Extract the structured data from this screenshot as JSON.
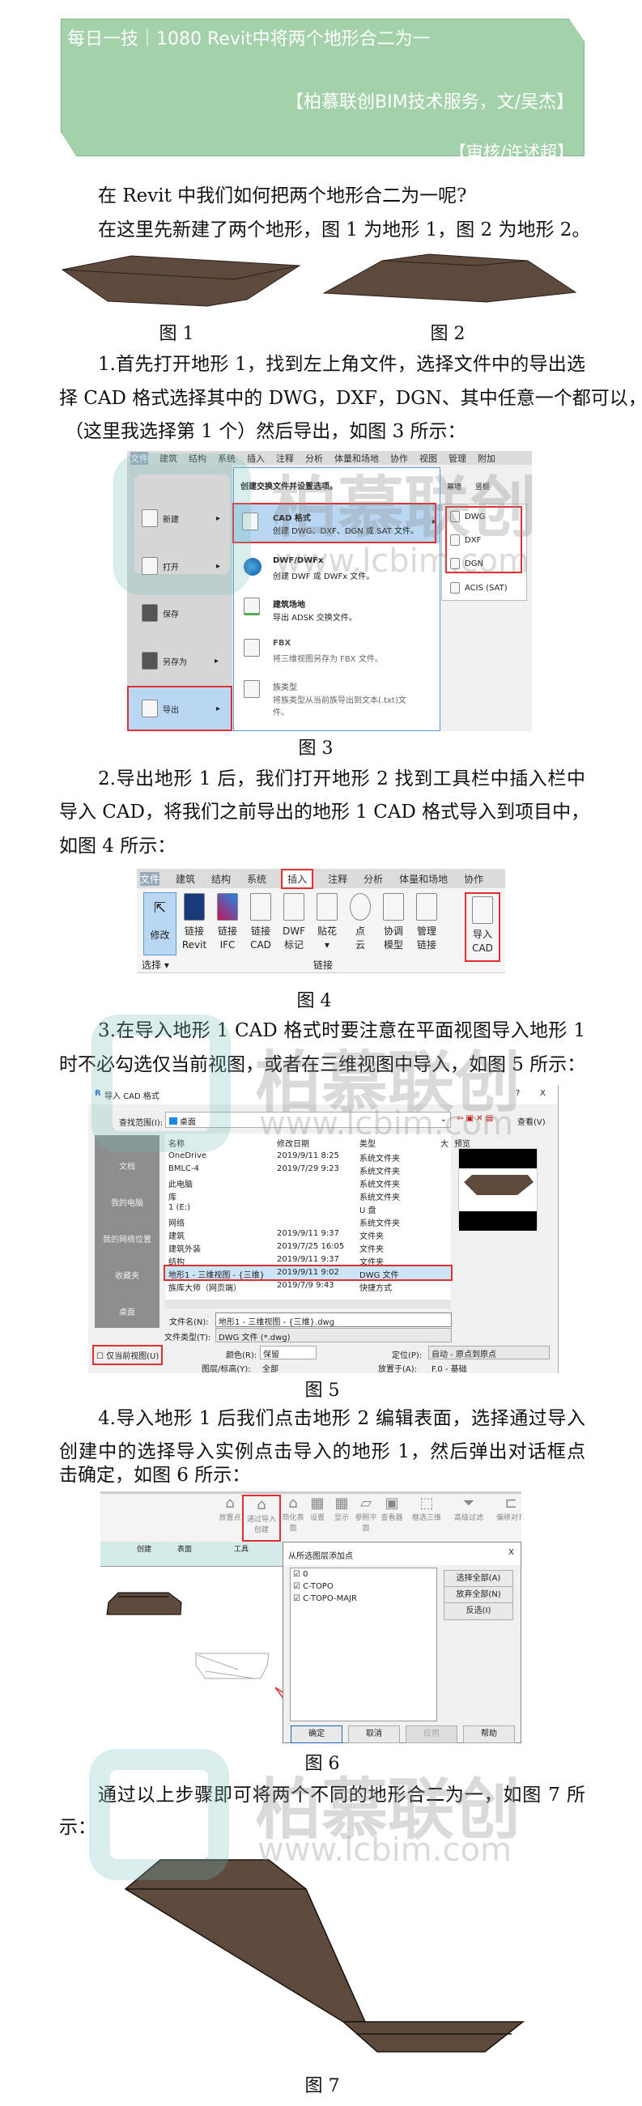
{
  "header": {
    "title": "每日一技｜1080 Revit中将两个地形合二为一",
    "author": "【柏慕联创BIM技术服务，文/吴杰】",
    "reviewer": "【审核/许述超】",
    "bg_color": "#a3d1aa"
  },
  "paragraphs": {
    "p1": [
      "在 Revit 中我们如何把两个地形合二为一呢?"
    ],
    "p2": [
      "在这里先新建了两个地形，图 1 为地形 1，图 2 为地形 2。"
    ],
    "p3": [
      "1.首先打开地形 1，找到左上角文件，选择文件中的导出选",
      "择 CAD 格式选择其中的 DWG，DXF，DGN、其中任意一个都可以，",
      "（这里我选择第 1 个）然后导出，如图 3 所示："
    ],
    "p4": [
      "2.导出地形 1 后，我们打开地形 2 找到工具栏中插入栏中",
      "导入 CAD，将我们之前导出的地形 1 CAD 格式导入到项目中，",
      "如图 4 所示："
    ],
    "p5": [
      "3.在导入地形 1 CAD 格式时要注意在平面视图导入地形 1",
      "时不必勾选仅当前视图，或者在三维视图中导入，如图 5 所示："
    ],
    "p6": [
      "4.导入地形 1 后我们点击地形 2 编辑表面，选择通过导入",
      "创建中的选择导入实例点击导入的地形 1，然后弹出对话框点",
      "击确定，如图 6 所示："
    ],
    "p7": [
      "通过以上步骤即可将两个不同的地形合二为一，如图 7 所",
      "示："
    ]
  },
  "captions": {
    "fig1": "图 1",
    "fig2": "图 2",
    "fig3": "图 3",
    "fig4": "图 4",
    "fig5": "图 5",
    "fig6": "图 6",
    "fig7": "图 7"
  },
  "terrain_color": "#5e4a3d",
  "fig3": {
    "tabs": [
      "文件",
      "建筑",
      "结构",
      "系统",
      "插入",
      "注释",
      "分析",
      "体量和场地",
      "协作",
      "视图",
      "管理",
      "附加"
    ],
    "left_menu": [
      "新建",
      "打开",
      "保存",
      "另存为",
      "导出"
    ],
    "panel_header": "创建交换文件并设置选项。",
    "items": [
      {
        "title": "CAD 格式",
        "desc": "创建 DWG、DXF、DGN 或 SAT 文件。"
      },
      {
        "title": "DWF/DWFx",
        "desc": "创建 DWF 或 DWFx 文件。"
      },
      {
        "title": "建筑场地",
        "desc": "导出 ADSK 交换文件。"
      },
      {
        "title": "FBX",
        "desc": "将三维视图另存为 FBX 文件。"
      },
      {
        "title": "族类型",
        "desc": "将族类型从当前族导出到文本(.txt)文件。"
      }
    ],
    "submenu": [
      "DWG",
      "DXF",
      "DGN",
      "ACIS (SAT)"
    ],
    "ribbon_labels": [
      "幕墙",
      "竖梃"
    ]
  },
  "fig4": {
    "tabs": [
      "文件",
      "建筑",
      "结构",
      "系统",
      "插入",
      "注释",
      "分析",
      "体量和场地",
      "协作"
    ],
    "modify": "修改",
    "select": "选择 ▾",
    "buttons": [
      [
        "链接",
        "Revit"
      ],
      [
        "链接",
        "IFC"
      ],
      [
        "链接",
        "CAD"
      ],
      [
        "DWF",
        "标记"
      ],
      [
        "贴花",
        "▾"
      ],
      [
        "点",
        "云"
      ],
      [
        "协调",
        "模型"
      ],
      [
        "管理",
        "链接"
      ]
    ],
    "import_cad": [
      "导入",
      "CAD"
    ],
    "group": "链接"
  },
  "fig5": {
    "title": "导入 CAD 格式",
    "help": "?",
    "close": "X",
    "lookin_label": "查找范围(I):",
    "lookin_value": "桌面",
    "view_label": "查看(V)",
    "places": [
      "文档",
      "我的电脑",
      "我的网络位置",
      "收藏夹",
      "桌面"
    ],
    "columns": [
      "名称",
      "修改日期",
      "类型",
      "大"
    ],
    "preview_label": "预览",
    "rows": [
      [
        "OneDrive",
        "2019/9/11 8:25",
        "系统文件夹"
      ],
      [
        "BMLC-4",
        "2019/7/29 9:23",
        "系统文件夹"
      ],
      [
        "此电脑",
        "",
        "系统文件夹"
      ],
      [
        "库",
        "",
        "系统文件夹"
      ],
      [
        "1 (E:)",
        "",
        "U 盘"
      ],
      [
        "网络",
        "",
        "系统文件夹"
      ],
      [
        "建筑",
        "2019/9/11 9:37",
        "文件夹"
      ],
      [
        "建筑外装",
        "2019/7/25 16:05",
        "文件夹"
      ],
      [
        "结构",
        "2019/9/11 9:37",
        "文件夹"
      ],
      [
        "地形1 - 三维视图 - {三维}",
        "2019/9/11 9:02",
        "DWG 文件"
      ],
      [
        "族库大师（网页端）",
        "2019/7/9 9:43",
        "快捷方式"
      ]
    ],
    "selected_row": 9,
    "filename_label": "文件名(N):",
    "filename_value": "地形1 - 三维视图 - {三维}.dwg",
    "filetype_label": "文件类型(T):",
    "filetype_value": "DWG 文件 (*.dwg)",
    "current_view_only": "仅当前视图(U)",
    "current_view_checked": false,
    "color_label": "颜色(R):",
    "color_value": "保留",
    "position_label": "定位(P):",
    "position_value": "自动 - 原点到原点",
    "layers_label": "图层/标高(Y):",
    "layers_value": "全部",
    "place_label": "放置于(A):",
    "place_value": "F.0 - 基础"
  },
  "fig6": {
    "ribbon": [
      "放置点",
      "通过导入创建",
      "简化表面",
      "设置",
      "显示",
      "参照平面",
      "查看器",
      "框选三维",
      "高级过滤",
      "偏移对齐"
    ],
    "groups": [
      "创建",
      "表面",
      "工具"
    ],
    "dialog_title": "从所选图层添加点",
    "close": "X",
    "layers": [
      "0",
      "C-TOPO",
      "C-TOPO-MAJR"
    ],
    "side_buttons": [
      "选择全部(A)",
      "放弃全部(N)",
      "反选(I)"
    ],
    "buttons": [
      "确定",
      "取消",
      "应用",
      "帮助"
    ]
  },
  "watermark": {
    "brand": "柏慕联创",
    "url": "www.lcbim.com"
  }
}
